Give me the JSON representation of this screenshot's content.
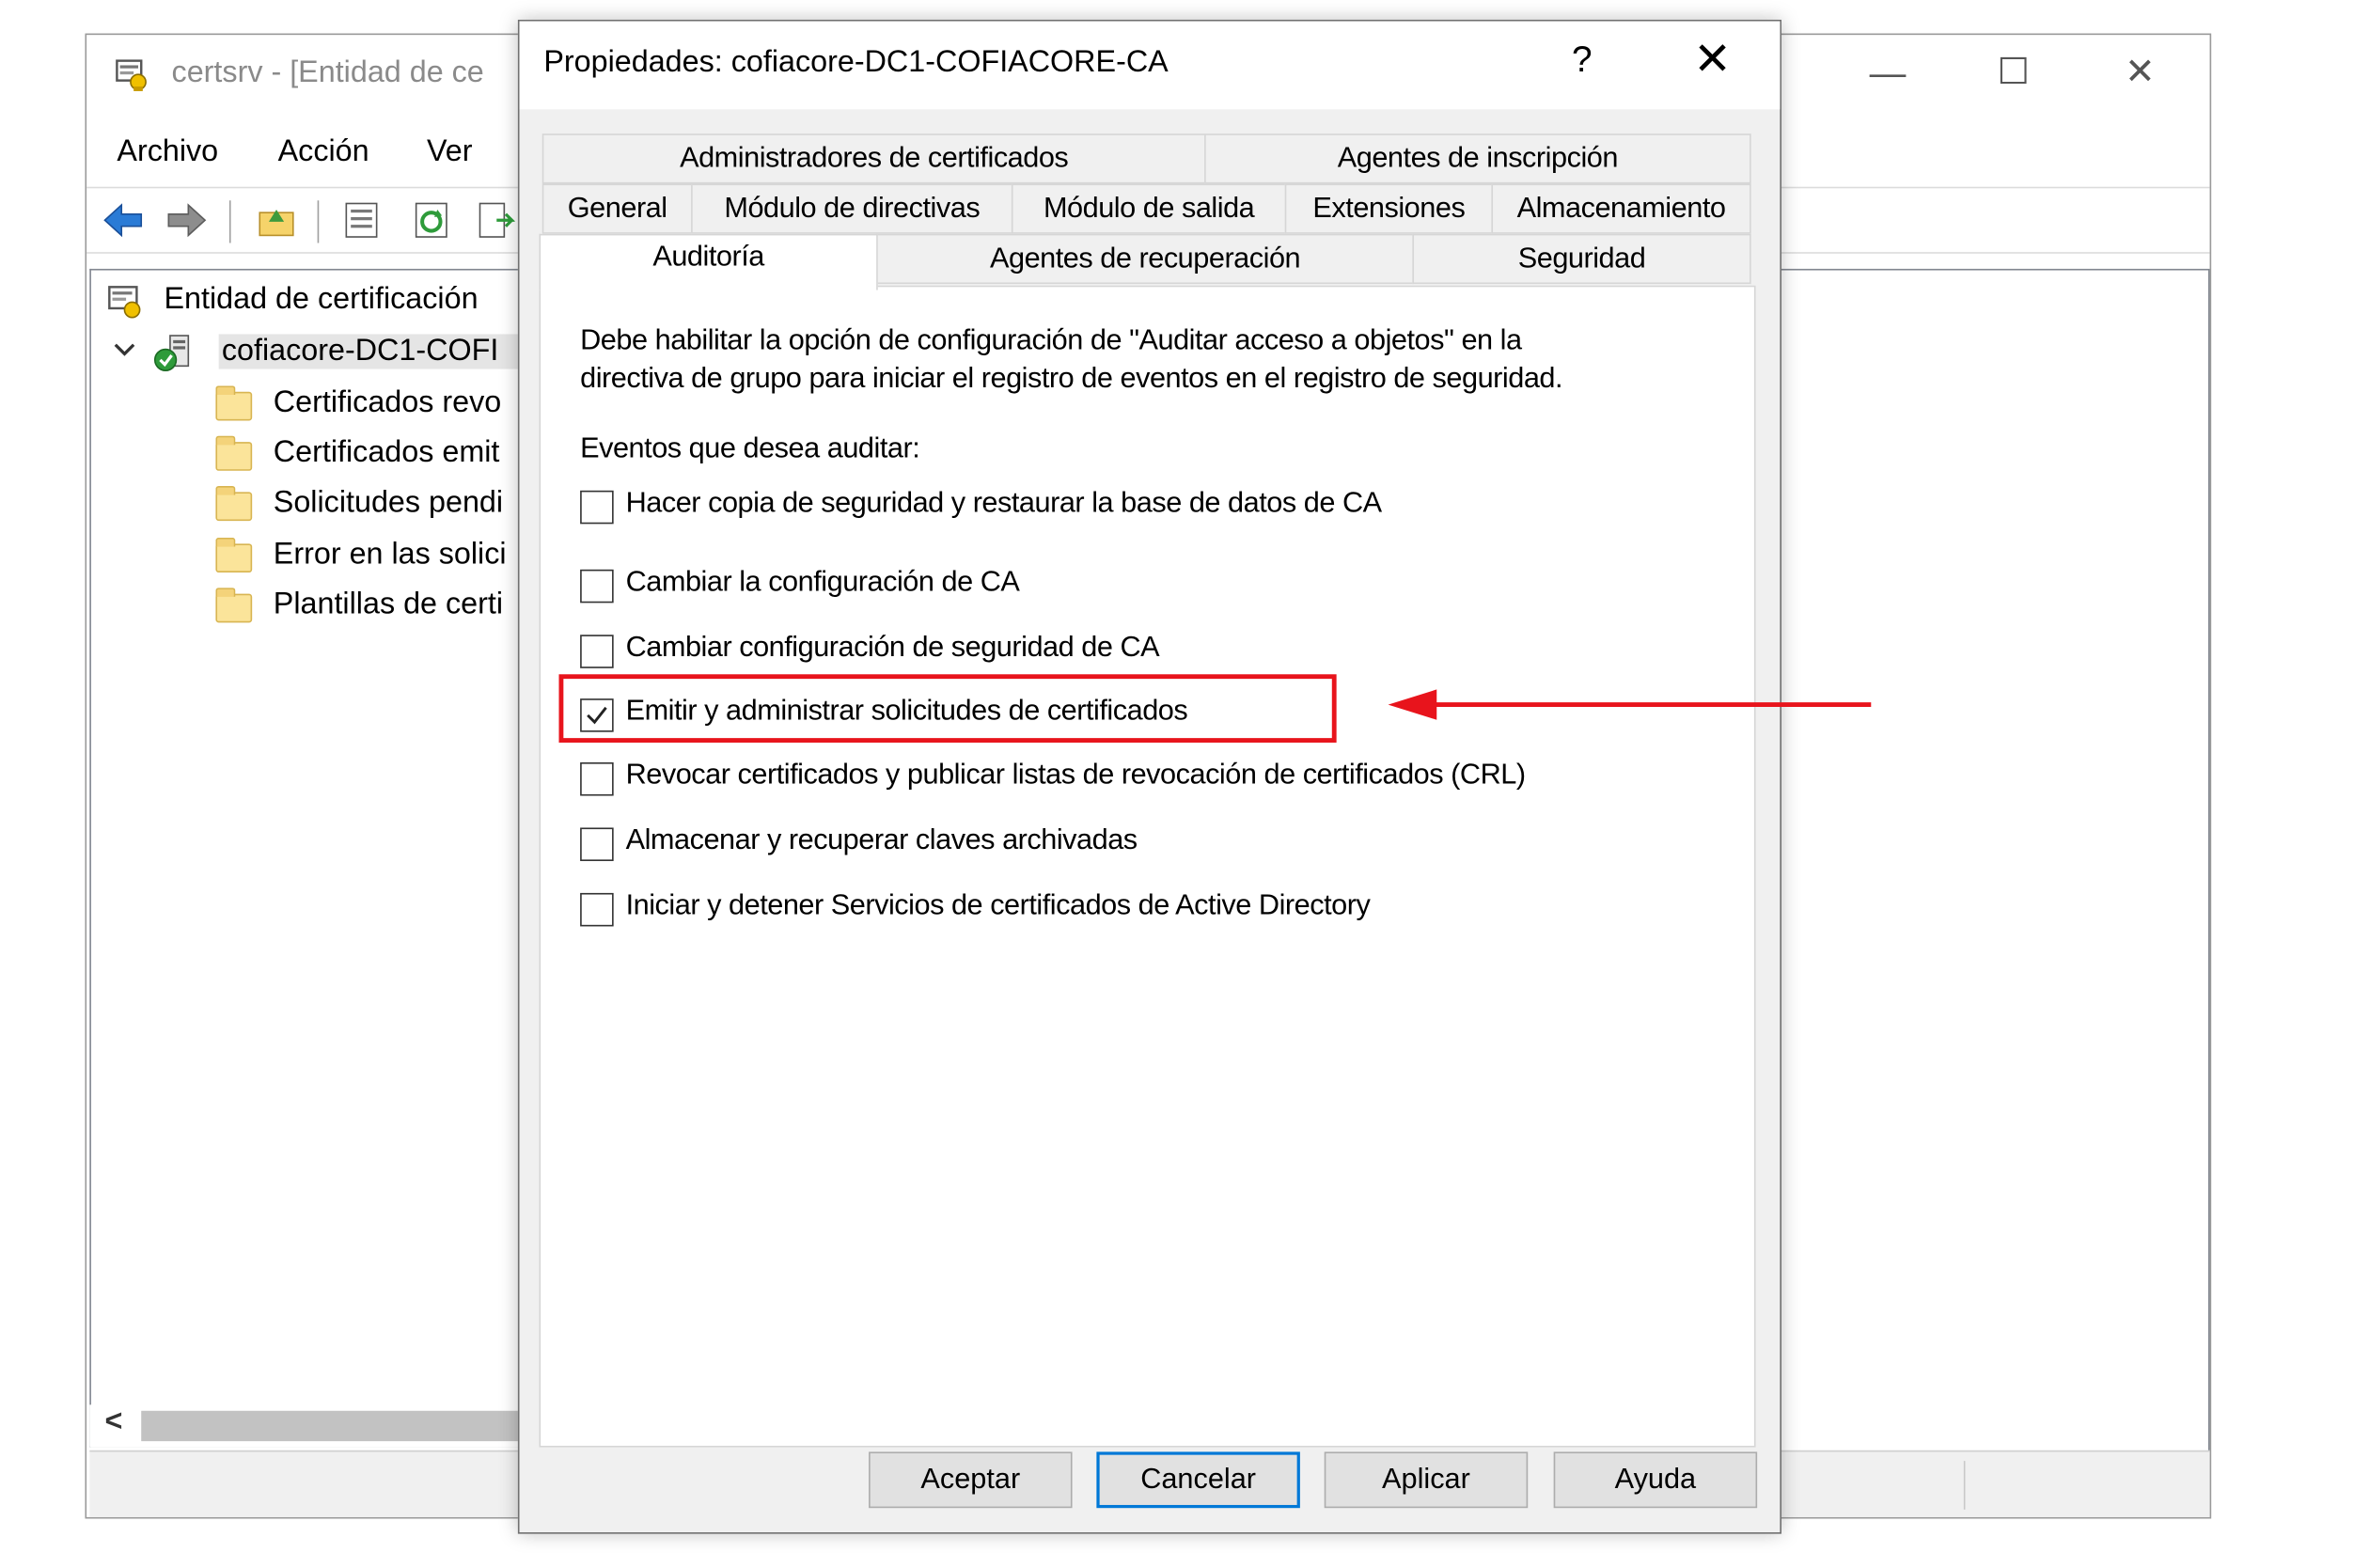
{
  "main_window": {
    "title": "certsrv - [Entidad de ce",
    "minimize": "—",
    "maximize": "☐",
    "close": "✕",
    "menu": [
      "Archivo",
      "Acción",
      "Ver"
    ],
    "tree": {
      "root": "Entidad de certificación",
      "ca_node": "cofiacore-DC1-COFI",
      "children": [
        "Certificados revo",
        "Certificados emit",
        "Solicitudes pendi",
        "Error en las solici",
        "Plantillas de certi"
      ]
    },
    "scroll_left": "<"
  },
  "dialog": {
    "title": "Propiedades: cofiacore-DC1-COFIACORE-CA",
    "help": "?",
    "close": "✕",
    "tabs_row1": [
      "Administradores de certificados",
      "Agentes de inscripción"
    ],
    "tabs_row2": [
      "General",
      "Módulo de directivas",
      "Módulo de salida",
      "Extensiones",
      "Almacenamiento"
    ],
    "tabs_row3": [
      "Auditoría",
      "Agentes de recuperación",
      "Seguridad"
    ],
    "active_tab": "Auditoría",
    "description_line1": "Debe habilitar la opción de configuración de \"Auditar acceso a objetos\" en la",
    "description_line2": "directiva de grupo para iniciar el registro de eventos en el registro de seguridad.",
    "events_label": "Eventos que desea auditar:",
    "checkboxes": [
      {
        "label": "Hacer copia de seguridad y restaurar la base de datos de CA",
        "checked": false
      },
      {
        "label": "Cambiar la configuración de CA",
        "checked": false
      },
      {
        "label": "Cambiar configuración de seguridad de CA",
        "checked": false
      },
      {
        "label": "Emitir y administrar solicitudes de certificados",
        "checked": true
      },
      {
        "label": "Revocar certificados y publicar listas de revocación de certificados (CRL)",
        "checked": false
      },
      {
        "label": "Almacenar y recuperar claves archivadas",
        "checked": false
      },
      {
        "label": "Iniciar y detener Servicios de certificados de Active Directory",
        "checked": false
      }
    ],
    "buttons": {
      "ok": "Aceptar",
      "cancel": "Cancelar",
      "apply": "Aplicar",
      "help": "Ayuda"
    }
  },
  "annotation": {
    "color": "#e8141c"
  }
}
